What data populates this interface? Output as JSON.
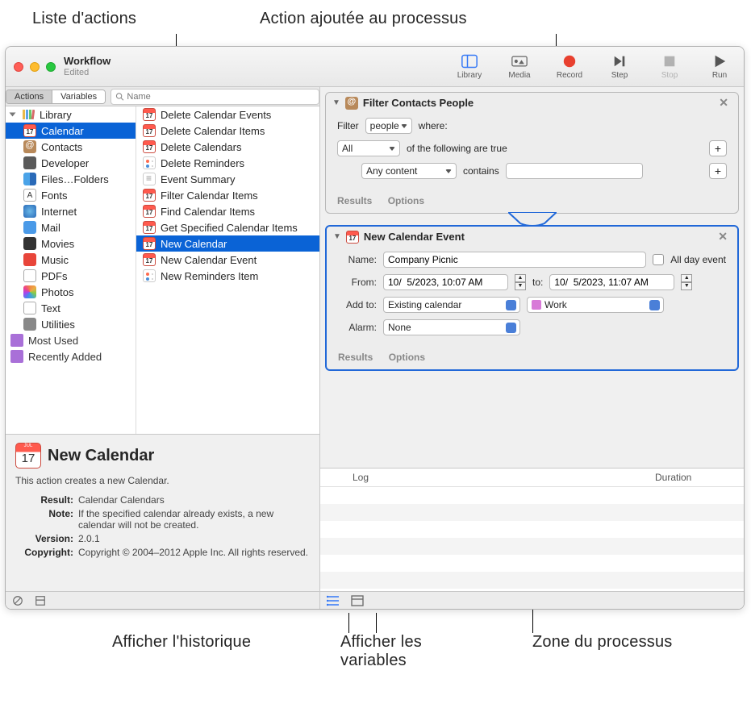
{
  "callouts": {
    "top_left": "Liste d'actions",
    "top_right": "Action ajoutée au processus",
    "bottom_left": "Afficher l'historique",
    "bottom_mid": "Afficher les variables",
    "bottom_right": "Zone du processus"
  },
  "window": {
    "title": "Workflow",
    "subtitle": "Edited"
  },
  "toolbar": {
    "library": "Library",
    "media": "Media",
    "record": "Record",
    "step": "Step",
    "stop": "Stop",
    "run": "Run"
  },
  "segments": {
    "actions": "Actions",
    "variables": "Variables"
  },
  "search_placeholder": "Name",
  "library_root": "Library",
  "categories": [
    {
      "label": "Calendar",
      "icon": "cal"
    },
    {
      "label": "Contacts",
      "icon": "contacts"
    },
    {
      "label": "Developer",
      "icon": "dev"
    },
    {
      "label": "Files…Folders",
      "icon": "finder"
    },
    {
      "label": "Fonts",
      "icon": "fonts"
    },
    {
      "label": "Internet",
      "icon": "internet"
    },
    {
      "label": "Mail",
      "icon": "mail"
    },
    {
      "label": "Movies",
      "icon": "movies"
    },
    {
      "label": "Music",
      "icon": "music"
    },
    {
      "label": "PDFs",
      "icon": "pdf"
    },
    {
      "label": "Photos",
      "icon": "photos"
    },
    {
      "label": "Text",
      "icon": "text"
    },
    {
      "label": "Utilities",
      "icon": "util"
    }
  ],
  "special_categories": [
    {
      "label": "Most Used"
    },
    {
      "label": "Recently Added"
    }
  ],
  "actions": [
    "Delete Calendar Events",
    "Delete Calendar Items",
    "Delete Calendars",
    "Delete Reminders",
    "Event Summary",
    "Filter Calendar Items",
    "Find Calendar Items",
    "Get Specified Calendar Items",
    "New Calendar",
    "New Calendar Event",
    "New Reminders Item"
  ],
  "selected_action_index": 8,
  "info": {
    "title": "New Calendar",
    "desc": "This action creates a new Calendar.",
    "result_label": "Result:",
    "result": "Calendar Calendars",
    "note_label": "Note:",
    "note": "If the specified calendar already exists, a new calendar will not be created.",
    "version_label": "Version:",
    "version": "2.0.1",
    "copyright_label": "Copyright:",
    "copyright": "Copyright © 2004–2012 Apple Inc.  All rights reserved."
  },
  "card1": {
    "title": "Filter Contacts People",
    "filter_label": "Filter",
    "filter_value": "people",
    "where": "where:",
    "all": "All",
    "of_following": "of the following are true",
    "any_content": "Any content",
    "contains": "contains",
    "results": "Results",
    "options": "Options"
  },
  "card2": {
    "title": "New Calendar Event",
    "name_label": "Name:",
    "name_value": "Company Picnic",
    "allday": "All day event",
    "from_label": "From:",
    "from_value": "10/  5/2023, 10:07 AM",
    "to_label": "to:",
    "to_value": "10/  5/2023, 11:07 AM",
    "addto_label": "Add to:",
    "addto_value": "Existing calendar",
    "calendar_name": "Work",
    "alarm_label": "Alarm:",
    "alarm_value": "None",
    "results": "Results",
    "options": "Options"
  },
  "log": {
    "log": "Log",
    "duration": "Duration"
  }
}
